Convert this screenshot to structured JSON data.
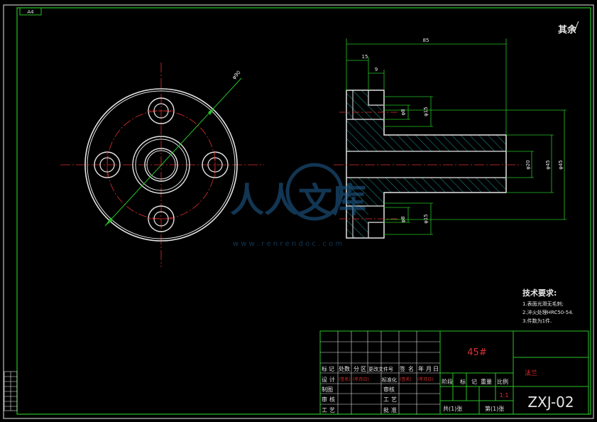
{
  "sheet": {
    "size_label": "A4",
    "drawing_no": "ZXJ-02",
    "material": "45#",
    "part_name": "法兰",
    "scale": "1:1"
  },
  "surface_finish": {
    "label": "其余"
  },
  "watermark": {
    "logo": "人人文库",
    "url": "w w w . r e n r e n d o c . c o m"
  },
  "dimensions": {
    "total_length": "85",
    "flange_thickness": "15",
    "counterbore_depth": "9",
    "bolt_circle": "φ90",
    "hole_top": "φ8",
    "cbore_top": "φ15",
    "hole_bottom": "φ8",
    "cbore_bottom": "φ15",
    "bore": "φ20",
    "hub": "φ45",
    "outer": "φ45"
  },
  "tech_notes": {
    "title": "技术要求:",
    "items": [
      "1.表面光滑无毛刺;",
      "2.淬火处理HRC50-54.",
      "3.件数为1件."
    ]
  },
  "title_block": {
    "header_cells": [
      "标",
      "记",
      "处数",
      "分",
      "区",
      "更改文件号",
      "签",
      "名",
      "年",
      "月",
      "日"
    ],
    "design": "设",
    "design2": "计",
    "sign_name": "(签名)",
    "sign_date": "(年月日)",
    "standardize": "标准化",
    "sign_name2": "(签名)",
    "sign_date2": "(年月日)",
    "draw": "制图",
    "approve": "审核",
    "check": "审",
    "check2": "核",
    "process": "工",
    "process2": "艺",
    "approval": "批",
    "approval2": "准",
    "stage_mark": "阶",
    "stage2": "段",
    "stage3": "标",
    "stage4": "记",
    "weight": "重量",
    "ratio": "比例",
    "total_sheets": "共(1)张",
    "sheet_no": "第(1)张"
  }
}
